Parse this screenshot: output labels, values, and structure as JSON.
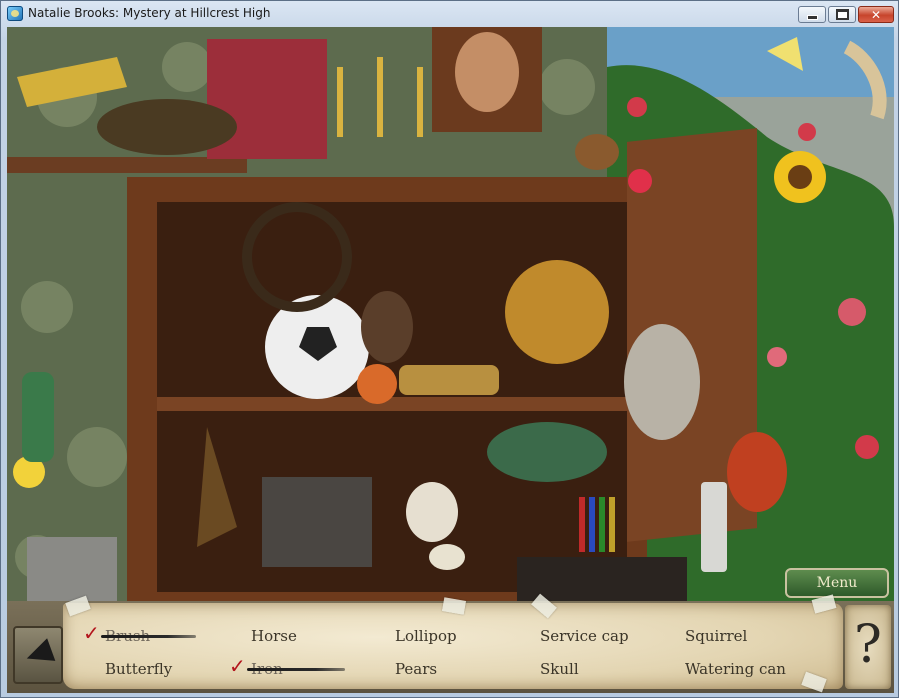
{
  "window": {
    "title": "Natalie Brooks: Mystery at Hillcrest High",
    "controls": {
      "minimize": "",
      "maximize": "",
      "close": "✕"
    }
  },
  "menu": {
    "label": "Menu"
  },
  "hint": {
    "label": "?"
  },
  "items": [
    {
      "label": "Brush",
      "found": true
    },
    {
      "label": "Butterfly",
      "found": false
    },
    {
      "label": "Horse",
      "found": false
    },
    {
      "label": "Iron",
      "found": true
    },
    {
      "label": "Lollipop",
      "found": false
    },
    {
      "label": "Pears",
      "found": false
    },
    {
      "label": "Service cap",
      "found": false
    },
    {
      "label": "Skull",
      "found": false
    },
    {
      "label": "Squirrel",
      "found": false
    },
    {
      "label": "Watering can",
      "found": false
    }
  ],
  "check_mark": "✓",
  "colors": {
    "titlebar": "#c3d3e6",
    "close_button": "#c7452c",
    "menu_button": "#2e5a2a",
    "parchment": "#e3d5b2",
    "check": "#b3141c"
  }
}
